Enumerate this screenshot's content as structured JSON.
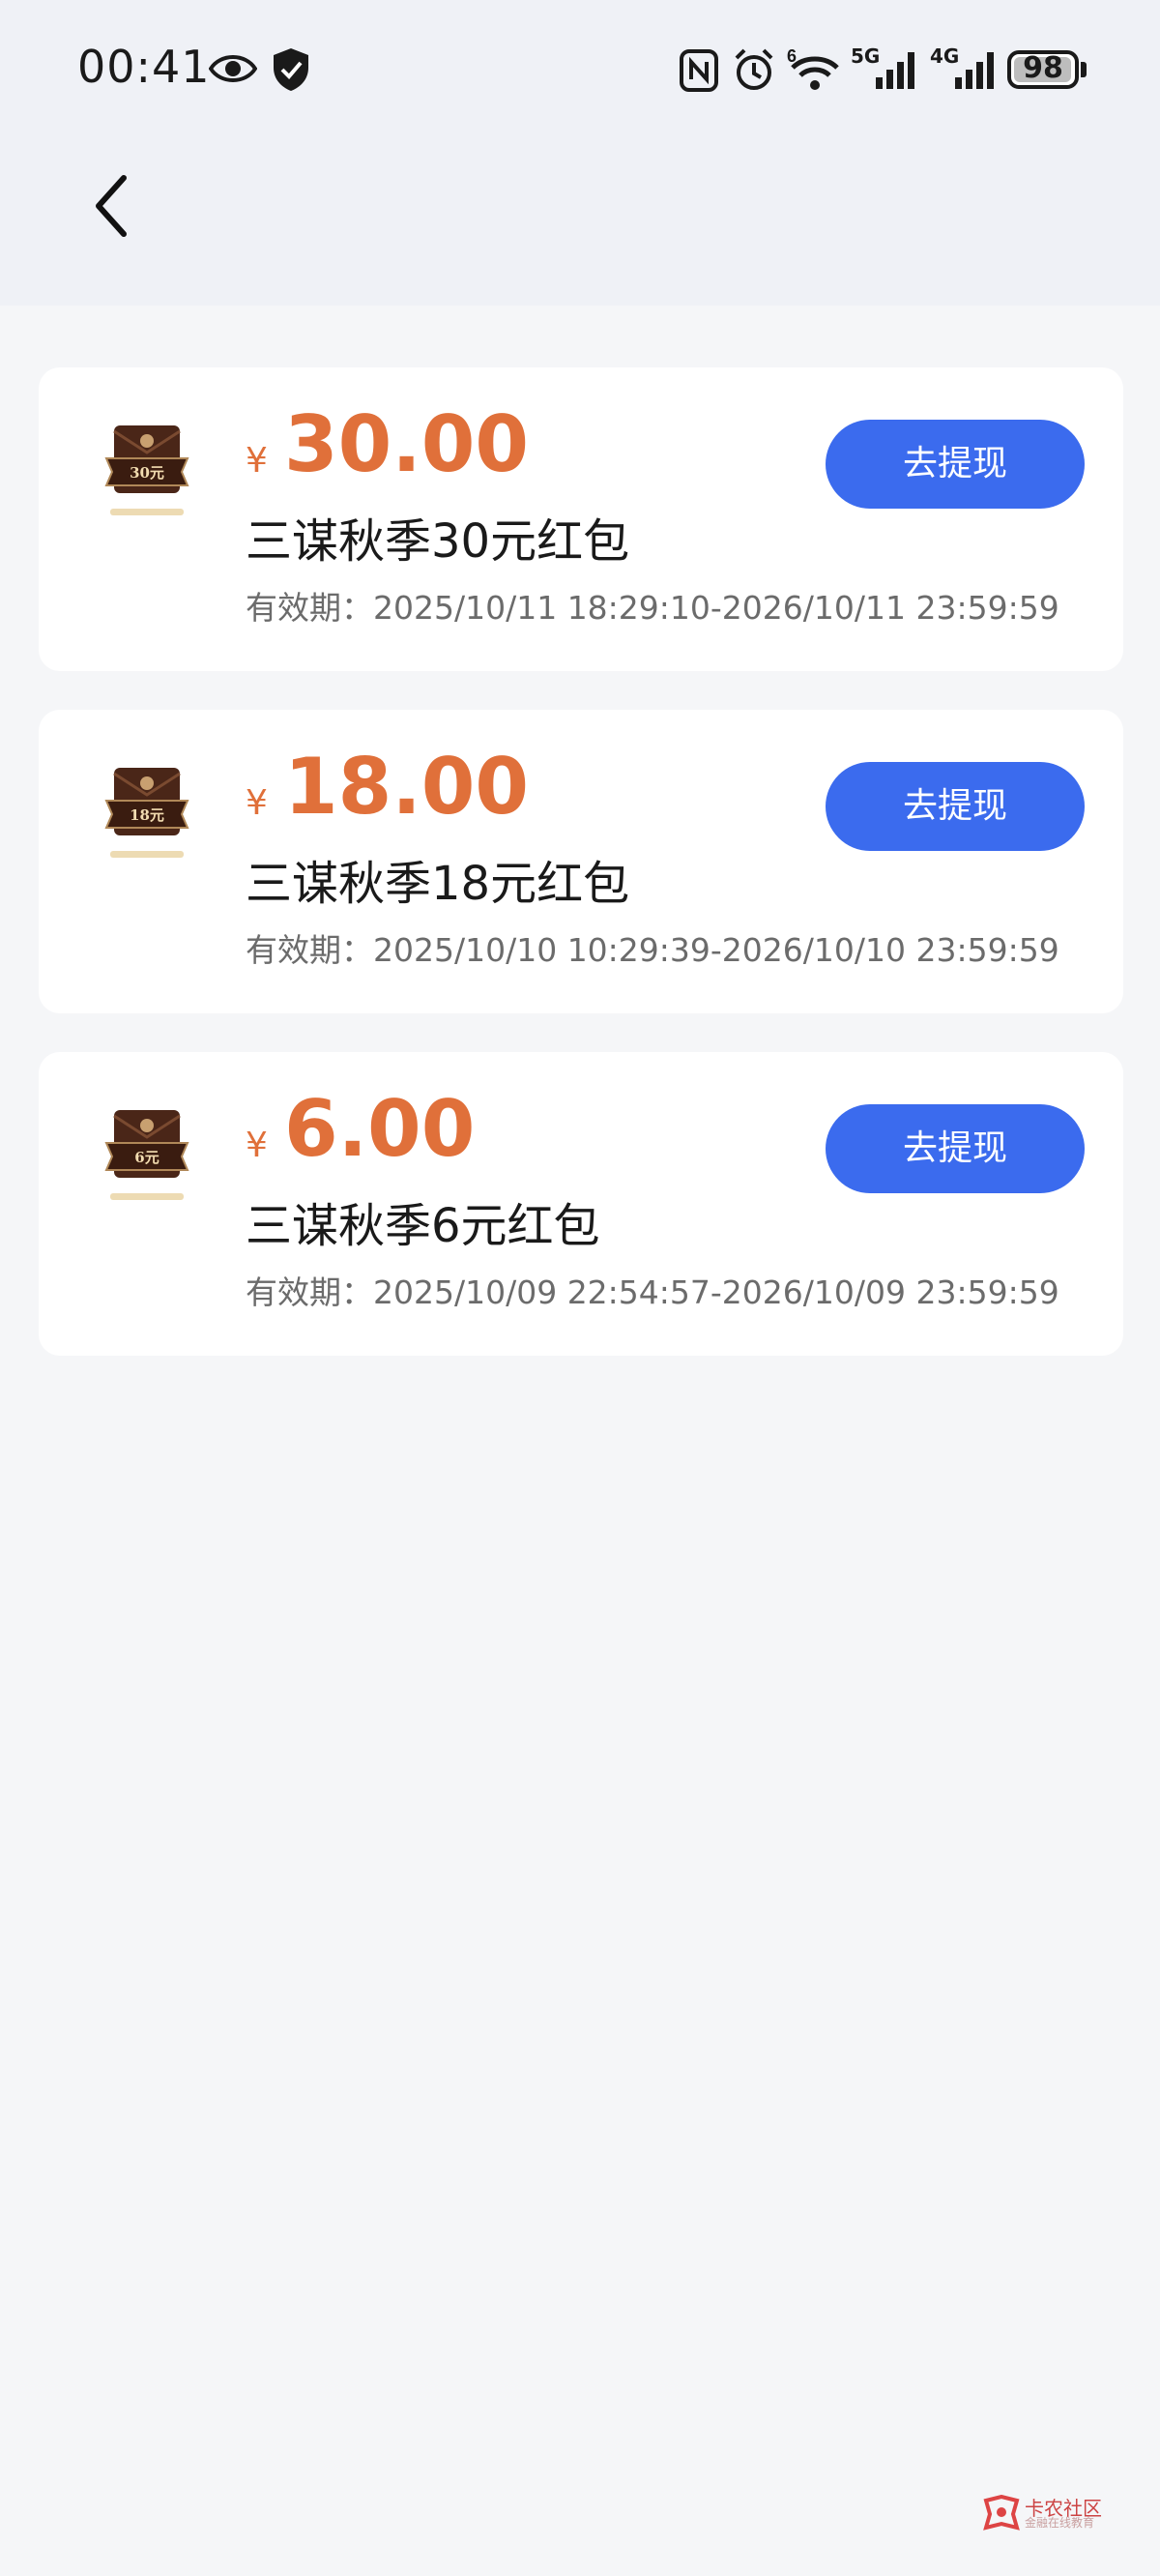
{
  "status_bar": {
    "time": "00:41",
    "wifi_label": "6",
    "signal1_label": "5G",
    "signal2_label": "4G",
    "battery": "98",
    "battery_level": 0.98
  },
  "coupons": [
    {
      "badge_text": "30元",
      "currency": "¥",
      "amount": "30.00",
      "title": "三谋秋季30元红包",
      "validity": "有效期：2025/10/11 18:29:10-2026/10/11 23:59:59",
      "button_label": "去提现"
    },
    {
      "badge_text": "18元",
      "currency": "¥",
      "amount": "18.00",
      "title": "三谋秋季18元红包",
      "validity": "有效期：2025/10/10 10:29:39-2026/10/10 23:59:59",
      "button_label": "去提现"
    },
    {
      "badge_text": "6元",
      "currency": "¥",
      "amount": "6.00",
      "title": "三谋秋季6元红包",
      "validity": "有效期：2025/10/09 22:54:57-2026/10/09 23:59:59",
      "button_label": "去提现"
    }
  ],
  "watermark": {
    "text": "卡农社区",
    "sub": "金融在线教育"
  },
  "colors": {
    "accent": "#3b6bee",
    "amount": "#e0703a",
    "header_bg": "#eff1f6",
    "page_bg": "#f5f6f8"
  }
}
